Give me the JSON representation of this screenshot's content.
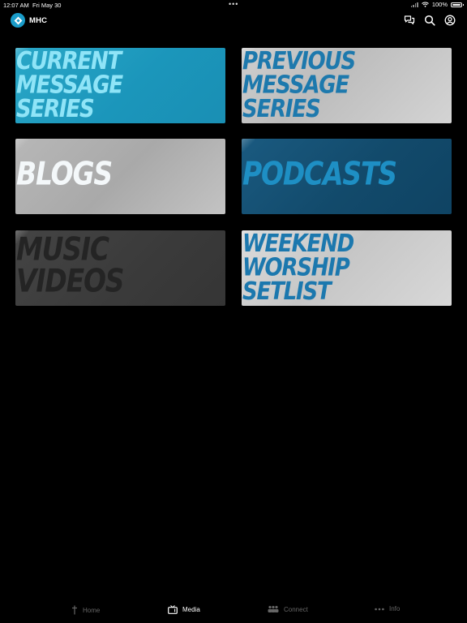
{
  "status_bar": {
    "time": "12:07 AM",
    "date": "Fri May 30",
    "battery": "100%"
  },
  "header": {
    "brand": "MHC",
    "icons": [
      "chat-icon",
      "search-icon",
      "account-icon"
    ]
  },
  "tiles": [
    {
      "id": "current",
      "text": "CURRENT\nMESSAGE\nSERIES"
    },
    {
      "id": "previous",
      "text": "PREVIOUS\nMESSAGE\nSERIES"
    },
    {
      "id": "blogs",
      "text": "BLOGS"
    },
    {
      "id": "podcasts",
      "text": "PODCASTS"
    },
    {
      "id": "music",
      "text": "MUSIC\nVIDEOS"
    },
    {
      "id": "weekend",
      "text": "WEEKEND\nWORSHIP\nSETLIST"
    }
  ],
  "tabbar": {
    "active": "Media",
    "tabs": [
      {
        "label": "Home",
        "icon": "cross-icon"
      },
      {
        "label": "Media",
        "icon": "tv-icon"
      },
      {
        "label": "Connect",
        "icon": "group-icon"
      },
      {
        "label": "Info",
        "icon": "more-icon"
      }
    ]
  },
  "colors": {
    "background": "#000000",
    "accent": "#1a9cc9",
    "current_tile": "#1b96bb",
    "podcasts_tile": "#124a6b"
  }
}
